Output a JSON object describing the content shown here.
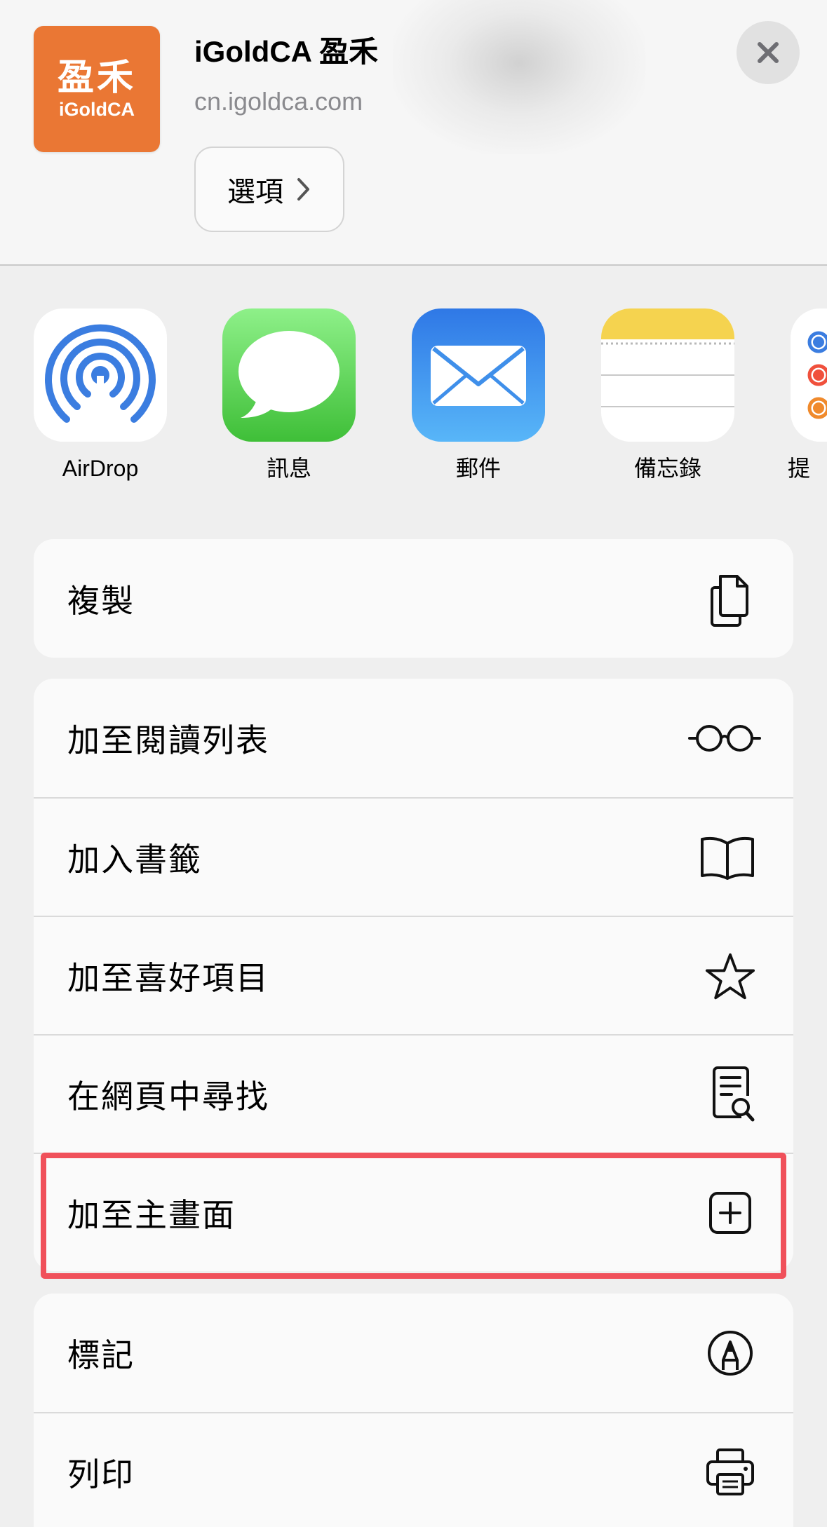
{
  "header": {
    "app_icon_text_zh": "盈禾",
    "app_icon_text_en": "iGoldCA",
    "title": "iGoldCA 盈禾",
    "url": "cn.igoldca.com",
    "options_label": "選項",
    "close_icon": "close-icon"
  },
  "share_apps": [
    {
      "label": "AirDrop",
      "icon": "airdrop-icon"
    },
    {
      "label": "訊息",
      "icon": "messages-icon"
    },
    {
      "label": "郵件",
      "icon": "mail-icon"
    },
    {
      "label": "備忘錄",
      "icon": "notes-icon"
    },
    {
      "label": "提",
      "icon": "reminders-icon"
    }
  ],
  "actions": {
    "copy": {
      "label": "複製",
      "icon": "copy-icon"
    },
    "reading_list": {
      "label": "加至閱讀列表",
      "icon": "glasses-icon"
    },
    "bookmark": {
      "label": "加入書籤",
      "icon": "book-icon"
    },
    "favorites": {
      "label": "加至喜好項目",
      "icon": "star-icon"
    },
    "find": {
      "label": "在網頁中尋找",
      "icon": "find-document-icon"
    },
    "home_screen": {
      "label": "加至主畫面",
      "icon": "plus-square-icon"
    },
    "markup": {
      "label": "標記",
      "icon": "markup-pen-icon"
    },
    "print": {
      "label": "列印",
      "icon": "printer-icon"
    }
  },
  "colors": {
    "app_icon_bg": "#ea7734",
    "highlight": "#f0505a",
    "messages": "#4cd964",
    "mail": "#3a8ef0",
    "notes_top": "#f5d34f"
  }
}
